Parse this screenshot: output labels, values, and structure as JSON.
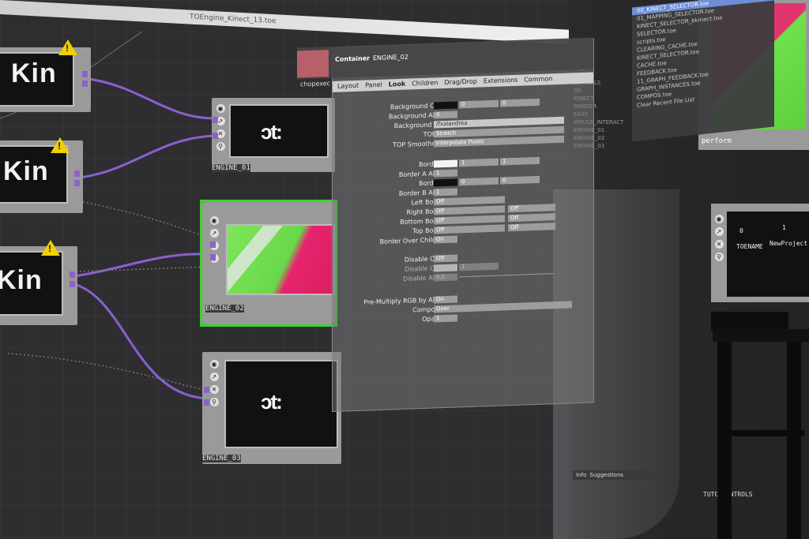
{
  "window": {
    "title": "TOEngine_Kinect_13.toe"
  },
  "kin_nodes": [
    {
      "text": "Kin"
    },
    {
      "text": "Kin"
    },
    {
      "text": "Kin"
    }
  ],
  "engine_nodes": [
    {
      "label": "ENGINE_01"
    },
    {
      "label": "ENGINE_02"
    },
    {
      "label": "ENGINE_03"
    }
  ],
  "logo_text": "ɔt:",
  "warning_glyph": "!",
  "param_panel": {
    "header": {
      "type": "Container",
      "name": "ENGINE_02",
      "node": "chopexec"
    },
    "tabs": [
      "Layout",
      "Panel",
      "Look",
      "Children",
      "Drag/Drop",
      "Extensions",
      "Common"
    ],
    "rows": [
      {
        "label": "Background Color",
        "values": [
          "0",
          "0"
        ]
      },
      {
        "label": "Background Alpha",
        "values": [
          "0"
        ]
      },
      {
        "label": "Background TOP",
        "values": [
          "/fxalandrea"
        ]
      },
      {
        "label": "TOP Fill",
        "values": [
          "Stretch"
        ]
      },
      {
        "label": "TOP Smoothness",
        "values": [
          "Interpolate Pixels"
        ]
      },
      {
        "label": "Border A",
        "values": [
          "1",
          "1"
        ]
      },
      {
        "label": "Border A Alpha",
        "values": [
          "1"
        ]
      },
      {
        "label": "Border B",
        "values": [
          "0",
          "0"
        ]
      },
      {
        "label": "Border B Alpha",
        "values": [
          "1"
        ]
      },
      {
        "label": "Left Border",
        "values": [
          "Off"
        ]
      },
      {
        "label": "Right Border",
        "values": [
          "Off",
          "Off"
        ]
      },
      {
        "label": "Bottom Border",
        "values": [
          "Off",
          "Off"
        ]
      },
      {
        "label": "Top Border",
        "values": [
          "Off",
          "Off"
        ]
      },
      {
        "label": "Border Over Children",
        "values": [
          "On"
        ]
      },
      {
        "label": "Disable Color",
        "values": [
          "Off"
        ]
      },
      {
        "label": "Disable Color",
        "values": [
          "1"
        ]
      },
      {
        "label": "Disable Alpha",
        "values": [
          "0.5"
        ]
      },
      {
        "label": "Pre-Multiply RGB by Alpha",
        "values": [
          "On"
        ]
      },
      {
        "label": "Composite",
        "values": [
          "Over"
        ]
      },
      {
        "label": "Opacity",
        "values": [
          "1"
        ]
      }
    ]
  },
  "menu": {
    "items": [
      "00_KINECT_SELECTOR.toe",
      "01_MAPPING_SELECTOR.toe",
      "KINECT_SELECTOR_bkinect.toe",
      "SELECTOR.toe",
      "scripts.toe",
      "CLEARING_CACHE.toe",
      "KINECT_SELECTOR.toe",
      "CACHE.toe",
      "FEEDBACK.toe",
      "11_GRAPH_FEEDBACK.toe",
      "GRAPH_INSTANCES.toe",
      "COMPOS.toe",
      "Clear Recent File List"
    ],
    "highlight_index": 0
  },
  "side_labels": [
    "FX_D..",
    "TOOLS",
    "UI_TOOLS",
    "3D",
    "KINECT",
    "RENDER",
    "EASY",
    "MOUSE_INTERACT",
    "ENGINE_01",
    "ENGINE_02",
    "ENGINE_03"
  ],
  "perform_label": "perform",
  "table_node": {
    "header": [
      "0",
      "1"
    ],
    "row": [
      "TOENAME",
      "NewProject"
    ]
  },
  "bottom_tabs": [
    "Info",
    "Suggestions"
  ],
  "tutorial_label": "TUTO_CONTROLS",
  "colors": {
    "wire": "#8a5fcf",
    "selected_border": "#38d62a",
    "warning": "#f0d000",
    "menu_highlight": "#6d8fd6"
  }
}
